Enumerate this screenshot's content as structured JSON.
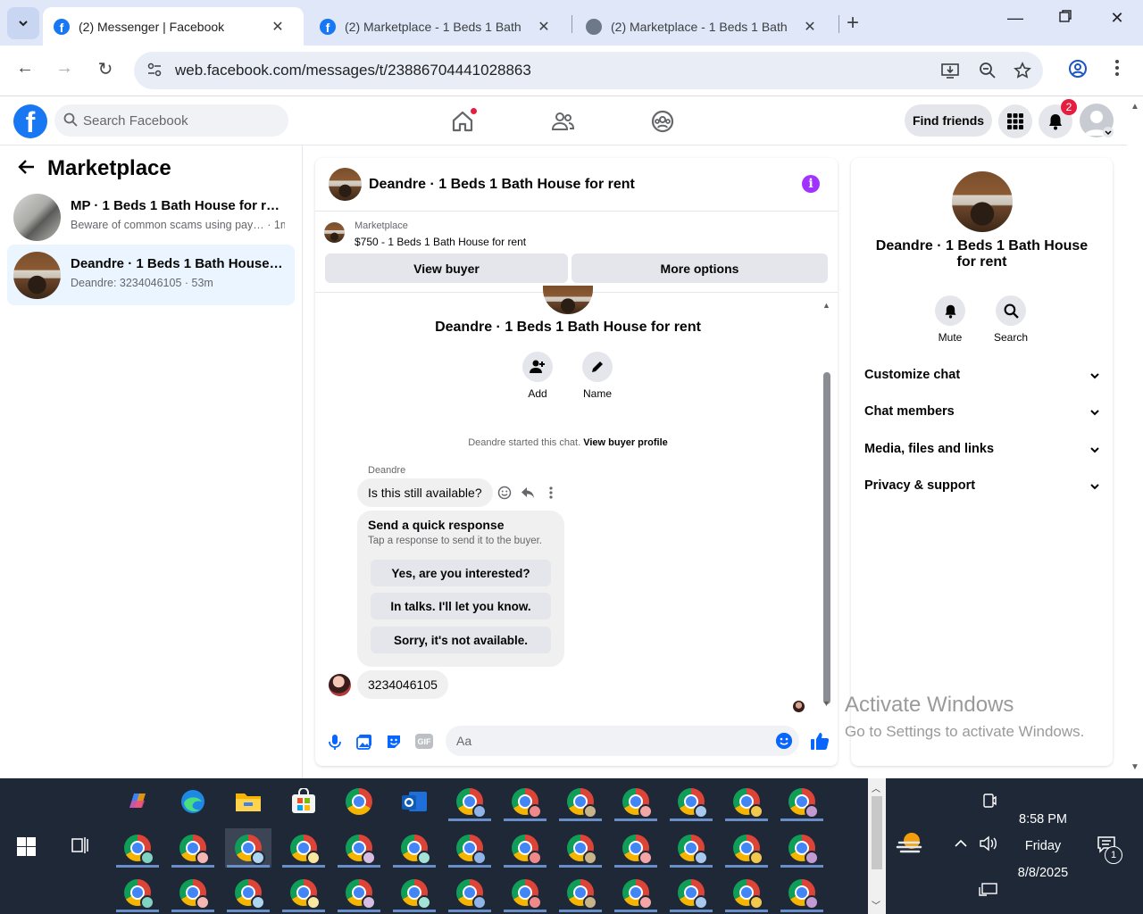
{
  "browser": {
    "tabs": [
      {
        "label": "(2) Messenger | Facebook",
        "active": true
      },
      {
        "label": "(2) Marketplace - 1 Beds 1 Bath",
        "active": false
      },
      {
        "label": "(2) Marketplace - 1 Beds 1 Bath",
        "active": false
      }
    ],
    "new_tab": "+",
    "url": "web.facebook.com/messages/t/23886704441028863"
  },
  "fb_header": {
    "search_placeholder": "Search Facebook",
    "find_friends": "Find friends",
    "notification_count": "2"
  },
  "left": {
    "title": "Marketplace",
    "conversations": [
      {
        "name": "MP · 1 Beds 1 Bath House for rent",
        "preview": "Beware of common scams using pay… · 1m",
        "selected": false
      },
      {
        "name": "Deandre · 1 Beds 1 Bath House for …",
        "preview": "Deandre: 3234046105 · 53m",
        "selected": true
      }
    ]
  },
  "chat": {
    "title": "Deandre · 1 Beds 1 Bath House for rent",
    "marketplace_label": "Marketplace",
    "listing": "$750 - 1 Beds 1 Bath House for rent",
    "view_buyer": "View buyer",
    "more_options": "More options",
    "hero_name": "Deandre · 1 Beds 1 Bath House for rent",
    "actions": [
      {
        "label": "Add"
      },
      {
        "label": "Name"
      }
    ],
    "started_text": "Deandre started this chat.",
    "view_buyer_profile": "View buyer profile",
    "sender": "Deandre",
    "message1": "Is this still available?",
    "quick_title": "Send a quick response",
    "quick_sub": "Tap a response to send it to the buyer.",
    "quick_options": [
      "Yes, are you interested?",
      "In talks. I'll let you know.",
      "Sorry, it's not available."
    ],
    "message2": "3234046105",
    "composer_placeholder": "Aa",
    "gif_label": "GIF"
  },
  "right": {
    "name": "Deandre · 1 Beds 1 Bath House for rent",
    "actions": [
      {
        "label": "Mute"
      },
      {
        "label": "Search"
      }
    ],
    "sections": [
      "Customize chat",
      "Chat members",
      "Media, files and links",
      "Privacy & support"
    ]
  },
  "watermark": {
    "line1": "Activate Windows",
    "line2": "Go to Settings to activate Windows."
  },
  "taskbar": {
    "time": "8:58 PM",
    "day": "Friday",
    "date": "8/8/2025",
    "notif_count": "1",
    "profile_colors": [
      "#8fb4e8",
      "#f08a8a",
      "#c9b48a",
      "#f4a6a6",
      "#a8c8f0",
      "#f2c94c",
      "#c39bd3",
      "#7fd3c0",
      "#f5b7b1",
      "#aed6f1",
      "#f9e79f",
      "#d7bde2",
      "#a3e4d7"
    ]
  }
}
